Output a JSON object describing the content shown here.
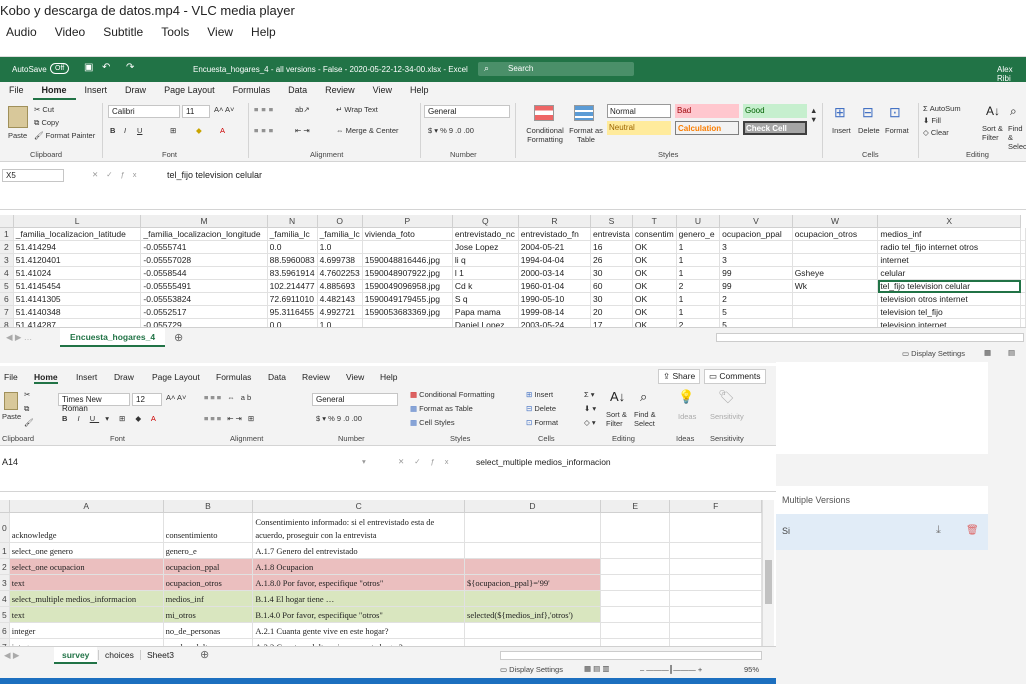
{
  "vlc": {
    "title": "Kobo y descarga de datos.mp4 - VLC media player",
    "menu": [
      "Audio",
      "Video",
      "Subtitle",
      "Tools",
      "View",
      "Help"
    ]
  },
  "excel1": {
    "autosave": "AutoSave",
    "autosave_state": "Off",
    "doc_title": "Encuesta_hogares_4 - all versions - False - 2020-05-22-12-34-00.xlsx - Excel",
    "search": "Search",
    "user": "Alex Ribi",
    "tabs": [
      "File",
      "Home",
      "Insert",
      "Draw",
      "Page Layout",
      "Formulas",
      "Data",
      "Review",
      "View",
      "Help"
    ],
    "clipboard": {
      "paste": "Paste",
      "cut": "Cut",
      "copy": "Copy",
      "format_painter": "Format Painter",
      "label": "Clipboard"
    },
    "font": {
      "name": "Calibri",
      "size": "11",
      "label": "Font"
    },
    "alignment": {
      "wrap": "Wrap Text",
      "merge": "Merge & Center",
      "label": "Alignment"
    },
    "number": {
      "format": "General",
      "label": "Number"
    },
    "styles": {
      "conditional": "Conditional Formatting",
      "format_table": "Format as Table",
      "normal": "Normal",
      "bad": "Bad",
      "good": "Good",
      "neutral": "Neutral",
      "calculation": "Calculation",
      "check_cell": "Check Cell",
      "label": "Styles"
    },
    "cells": {
      "insert": "Insert",
      "delete": "Delete",
      "format": "Format",
      "label": "Cells"
    },
    "editing": {
      "autosum": "AutoSum",
      "fill": "Fill",
      "clear": "Clear",
      "sort": "Sort & Filter",
      "find": "Find & Select",
      "label": "Editing"
    },
    "namebox": "X5",
    "formula": "tel_fijo television celular",
    "columns": [
      "L",
      "M",
      "N",
      "O",
      "P",
      "Q",
      "R",
      "S",
      "T",
      "U",
      "V",
      "W",
      "X"
    ],
    "rows": [
      {
        "n": "1",
        "c": [
          "_familia_localizacion_latitude",
          "_familia_localizacion_longitude",
          "_familia_lc",
          "_familia_lc",
          "vivienda_foto",
          "entrevistado_nc",
          "entrevistado_fn",
          "entrevista",
          "consentim",
          "genero_e",
          "ocupacion_ppal",
          "ocupacion_otros",
          "medios_inf"
        ]
      },
      {
        "n": "2",
        "c": [
          "51.414294",
          "-0.0555741",
          "0.0",
          "1.0",
          "",
          "Jose Lopez",
          "2004-05-21",
          "16",
          "OK",
          "1",
          "3",
          "",
          "radio tel_fijo internet otros"
        ]
      },
      {
        "n": "3",
        "c": [
          "51.4120401",
          "-0.05557028",
          "88.5960083",
          "4.699738",
          "1590048816446.jpg",
          "li q",
          "1994-04-04",
          "26",
          "OK",
          "1",
          "3",
          "",
          "internet"
        ]
      },
      {
        "n": "4",
        "c": [
          "51.41024",
          "-0.0558544",
          "83.5961914",
          "4.7602253",
          "1590048907922.jpg",
          "l 1",
          "2000-03-14",
          "30",
          "OK",
          "1",
          "99",
          "Gsheye",
          "celular"
        ]
      },
      {
        "n": "5",
        "c": [
          "51.4145454",
          "-0.05555491",
          "102.214477",
          "4.885693",
          "1590049096958.jpg",
          "Cd k",
          "1960-01-04",
          "60",
          "OK",
          "2",
          "99",
          "Wk",
          "tel_fijo television celular"
        ]
      },
      {
        "n": "6",
        "c": [
          "51.4141305",
          "-0.05553824",
          "72.6911010",
          "4.482143",
          "1590049179455.jpg",
          "S q",
          "1990-05-10",
          "30",
          "OK",
          "1",
          "2",
          "",
          "television otros internet"
        ]
      },
      {
        "n": "7",
        "c": [
          "51.4140348",
          "-0.0552517",
          "95.3116455",
          "4.992721",
          "1590053683369.jpg",
          "Papa mama",
          "1999-08-14",
          "20",
          "OK",
          "1",
          "5",
          "",
          "television tel_fijo"
        ]
      },
      {
        "n": "8",
        "c": [
          "51.414287",
          "-0.055729",
          "0.0",
          "1.0",
          "",
          "Daniel Lopez",
          "2003-05-24",
          "17",
          "OK",
          "2",
          "5",
          "",
          "television internet"
        ]
      }
    ],
    "sheet_tab": "Encuesta_hogares_4",
    "display_settings": "Display Settings"
  },
  "excel2": {
    "tabs": [
      "File",
      "Home",
      "Insert",
      "Draw",
      "Page Layout",
      "Formulas",
      "Data",
      "Review",
      "View",
      "Help"
    ],
    "share": "Share",
    "comments": "Comments",
    "font": {
      "name": "Times New Roman",
      "size": "12",
      "label": "Font"
    },
    "clipboard_label": "Clipboard",
    "alignment_label": "Alignment",
    "number": {
      "format": "General",
      "label": "Number"
    },
    "styles": {
      "conditional": "Conditional Formatting",
      "format_table": "Format as Table",
      "cell_styles": "Cell Styles",
      "label": "Styles"
    },
    "cells": {
      "insert": "Insert",
      "delete": "Delete",
      "format": "Format",
      "label": "Cells"
    },
    "editing": {
      "sort": "Sort & Filter",
      "find": "Find & Select",
      "label": "Editing"
    },
    "ideas": {
      "btn": "Ideas",
      "label": "Ideas"
    },
    "sensitivity": {
      "btn": "Sensitivity",
      "label": "Sensitivity"
    },
    "paste": "Paste",
    "namebox": "A14",
    "formula": "select_multiple medios_informacion",
    "columns": [
      "A",
      "B",
      "C",
      "D",
      "E",
      "F"
    ],
    "rows": [
      {
        "n": "0",
        "c": [
          "acknowledge",
          "consentimiento",
          "Consentimiento informado: si el entrevistado esta de acuerdo, proseguir con la entrevista",
          "",
          "",
          ""
        ],
        "style": "tall"
      },
      {
        "n": "1",
        "c": [
          "select_one genero",
          "genero_e",
          "A.1.7 Genero del entrevistado",
          "",
          "",
          ""
        ],
        "style": ""
      },
      {
        "n": "2",
        "c": [
          "select_one ocupacion",
          "ocupacion_ppal",
          "A.1.8 Ocupacion",
          "",
          "",
          ""
        ],
        "style": "pink"
      },
      {
        "n": "3",
        "c": [
          "text",
          "ocupacion_otros",
          "A.1.8.0 Por favor, especifique \"otros\"",
          "${ocupacion_ppal}='99'",
          "",
          ""
        ],
        "style": "pink"
      },
      {
        "n": "4",
        "c": [
          "select_multiple medios_informacion",
          "medios_inf",
          "B.1.4 El hogar tiene …",
          "",
          "",
          ""
        ],
        "style": "green"
      },
      {
        "n": "5",
        "c": [
          "text",
          "mi_otros",
          "B.1.4.0 Por favor, especifique \"otros\"",
          "selected(${medios_inf},'otros')",
          "",
          ""
        ],
        "style": "green"
      },
      {
        "n": "6",
        "c": [
          "integer",
          "no_de_personas",
          "A.2.1 Cuanta gente vive en este hogar?",
          "",
          "",
          ""
        ],
        "style": ""
      },
      {
        "n": "7",
        "c": [
          "integer",
          "no_de_adultos",
          "A.2.2 Cuantos adultos viven en este hogar?",
          "",
          "",
          ""
        ],
        "style": ""
      }
    ],
    "sheet_tabs": [
      "survey",
      "choices",
      "Sheet3"
    ],
    "display_settings": "Display Settings",
    "zoom": "95%"
  },
  "side": {
    "multiple_versions": "Multiple Versions",
    "version_item": "Si"
  }
}
